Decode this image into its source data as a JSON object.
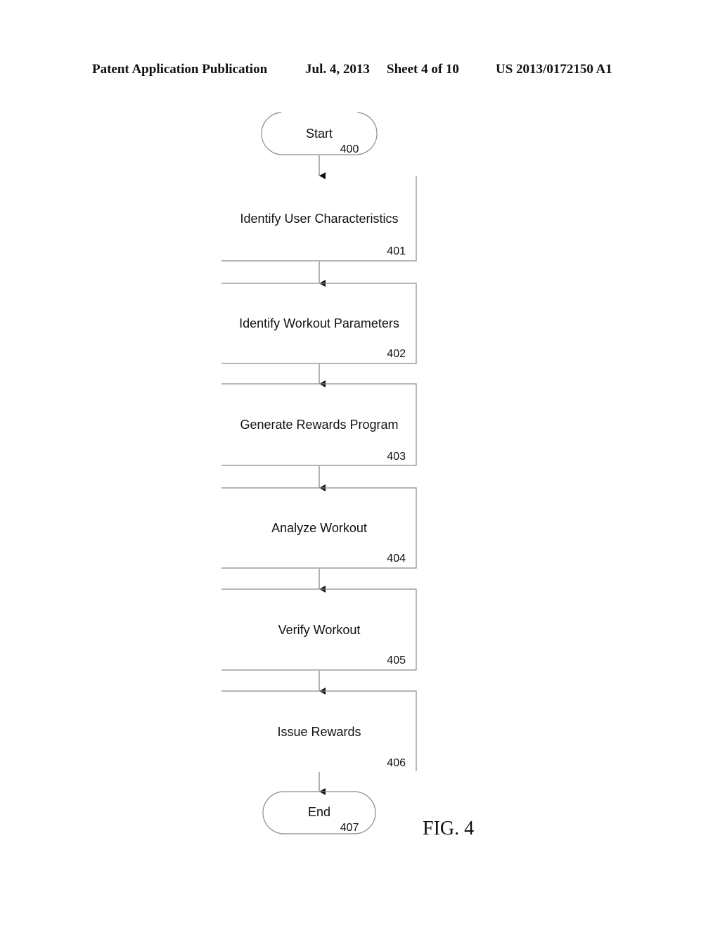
{
  "header": {
    "publication": "Patent Application Publication",
    "date": "Jul. 4, 2013",
    "sheet": "Sheet 4 of 10",
    "number": "US 2013/0172150 A1"
  },
  "flowchart": {
    "start": {
      "label": "Start",
      "ref": "400"
    },
    "steps": [
      {
        "label": "Identify User Characteristics",
        "ref": "401"
      },
      {
        "label": "Identify Workout Parameters",
        "ref": "402"
      },
      {
        "label": "Generate Rewards Program",
        "ref": "403"
      },
      {
        "label": "Analyze Workout",
        "ref": "404"
      },
      {
        "label": "Verify Workout",
        "ref": "405"
      },
      {
        "label": "Issue Rewards",
        "ref": "406"
      }
    ],
    "end": {
      "label": "End",
      "ref": "407"
    }
  },
  "figure_label": "FIG. 4"
}
